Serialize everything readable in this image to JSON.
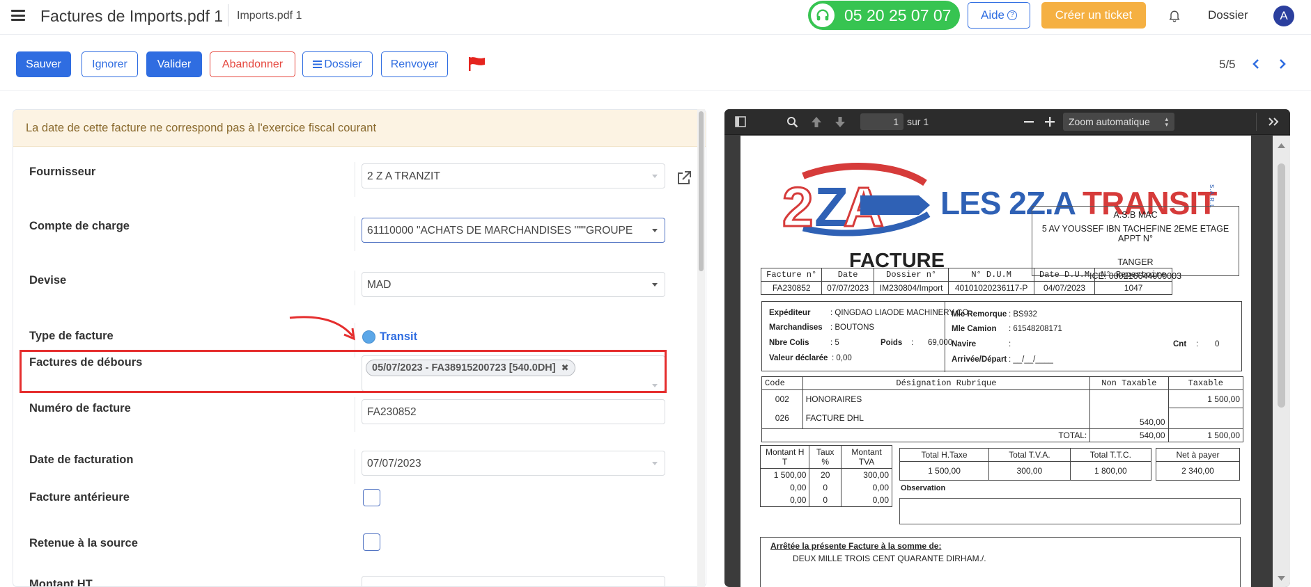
{
  "header": {
    "title": "Factures de Imports.pdf 1",
    "subtitle": "Imports.pdf 1",
    "phone": "05 20 25 07 07",
    "help_label": "Aide",
    "help_glyph": "?",
    "ticket_label": "Créer un ticket",
    "dossier_label": "Dossier",
    "avatar_letter": "A"
  },
  "toolbar": {
    "save": "Sauver",
    "ignore": "Ignorer",
    "validate": "Valider",
    "abandon": "Abandonner",
    "dossier": "Dossier",
    "resend": "Renvoyer",
    "pager": "5/5"
  },
  "form": {
    "warning": "La date de cette facture ne correspond pas à l'exercice fiscal courant",
    "fournisseur_label": "Fournisseur",
    "fournisseur_value": "2 Z A TRANZIT",
    "compte_label": "Compte de charge",
    "compte_value": "61110000 \"ACHATS DE MARCHANDISES \"\"\"GROUPE",
    "devise_label": "Devise",
    "devise_value": "MAD",
    "type_label": "Type de facture",
    "type_value": "Transit",
    "debours_label": "Factures de débours",
    "debours_tag": "05/07/2023 - FA38915200723 [540.0DH]",
    "debours_tag_remove": "✖",
    "numero_label": "Numéro de facture",
    "numero_value": "FA230852",
    "date_label": "Date de facturation",
    "date_value": "07/07/2023",
    "anterieure_label": "Facture antérieure",
    "retenue_label": "Retenue à la source",
    "montant_label": "Montant HT"
  },
  "viewer": {
    "page_current": "1",
    "page_total_label": "sur 1",
    "zoom_label": "Zoom automatique"
  },
  "pdf": {
    "logo_main": "LES 2Z.A",
    "logo_red": "TRANSIT",
    "logo_badge": "TRANSIT",
    "logo_sarl": "S.A.R.L",
    "addr_l1": "A.S.B MAC",
    "addr_l2": "5 AV YOUSSEF IBN TACHEFINE 2EME ETAGE APPT N°",
    "addr_l3": "TANGER",
    "addr_l4": "ICE: 000216644000003",
    "facture_title": "FACTURE",
    "head_cols": [
      "Facture n°",
      "Date",
      "Dossier n°",
      "N° D.U.M",
      "Date D.U.M",
      "N° Repertoire"
    ],
    "head_vals": [
      "FA230852",
      "07/07/2023",
      "IM230804/Import",
      "40101020236117-P",
      "04/07/2023",
      "1047"
    ],
    "expediteur_label": "Expéditeur",
    "expediteur_value": ": QINGDAO LIAODE MACHINERY CO",
    "marchandises_label": "Marchandises",
    "marchandises_value": ": BOUTONS",
    "colis_label": "Nbre Colis",
    "colis_value": ": 5",
    "poids_label": "Poids",
    "poids_value": ":",
    "poids_num": "69,000",
    "valeur_label": "Valeur déclarée",
    "valeur_value": ": 0,00",
    "remorque_label": "Mle Remorque",
    "remorque_value": ": BS932",
    "camion_label": "Mle Camion",
    "camion_value": ": 61548208171",
    "navire_label": "Navire",
    "navire_value": ":",
    "cnt_label": "Cnt",
    "cnt_value": ":",
    "cnt_num": "0",
    "arrivee_label": "Arrivée/Départ",
    "arrivee_value": ": __/__/____",
    "lines_cols": [
      "Code",
      "Désignation Rubrique",
      "Non Taxable",
      "Taxable"
    ],
    "lines": [
      {
        "code": "002",
        "designation": "HONORAIRES",
        "non_taxable": "",
        "taxable": "1 500,00"
      },
      {
        "code": "026",
        "designation": "FACTURE DHL",
        "non_taxable": "540,00",
        "taxable": ""
      }
    ],
    "total_label": "TOTAL:",
    "total_non_taxable": "540,00",
    "total_taxable": "1 500,00",
    "tva_cols": [
      "Montant H T",
      "Taux %",
      "Montant TVA"
    ],
    "tva_rows": [
      [
        "1 500,00",
        "20",
        "300,00"
      ],
      [
        "0,00",
        "0",
        "0,00"
      ],
      [
        "0,00",
        "0",
        "0,00"
      ]
    ],
    "totals_cols": [
      "Total H.Taxe",
      "Total T.V.A.",
      "Total T.T.C.",
      "Net à payer"
    ],
    "totals_vals": [
      "1 500,00",
      "300,00",
      "1 800,00",
      "2 340,00"
    ],
    "observation_label": "Observation",
    "arretee_label": "Arrêtée la présente Facture à la somme de:",
    "arretee_value": "DEUX MILLE TROIS CENT QUARANTE DIRHAM./."
  },
  "colors": {
    "primary": "#2f6de1",
    "phone_green": "#37c451",
    "ticket_orange": "#f5b042",
    "danger": "#e5473e",
    "highlight": "#e52e2e",
    "warning_bg": "#fcf3e3"
  }
}
